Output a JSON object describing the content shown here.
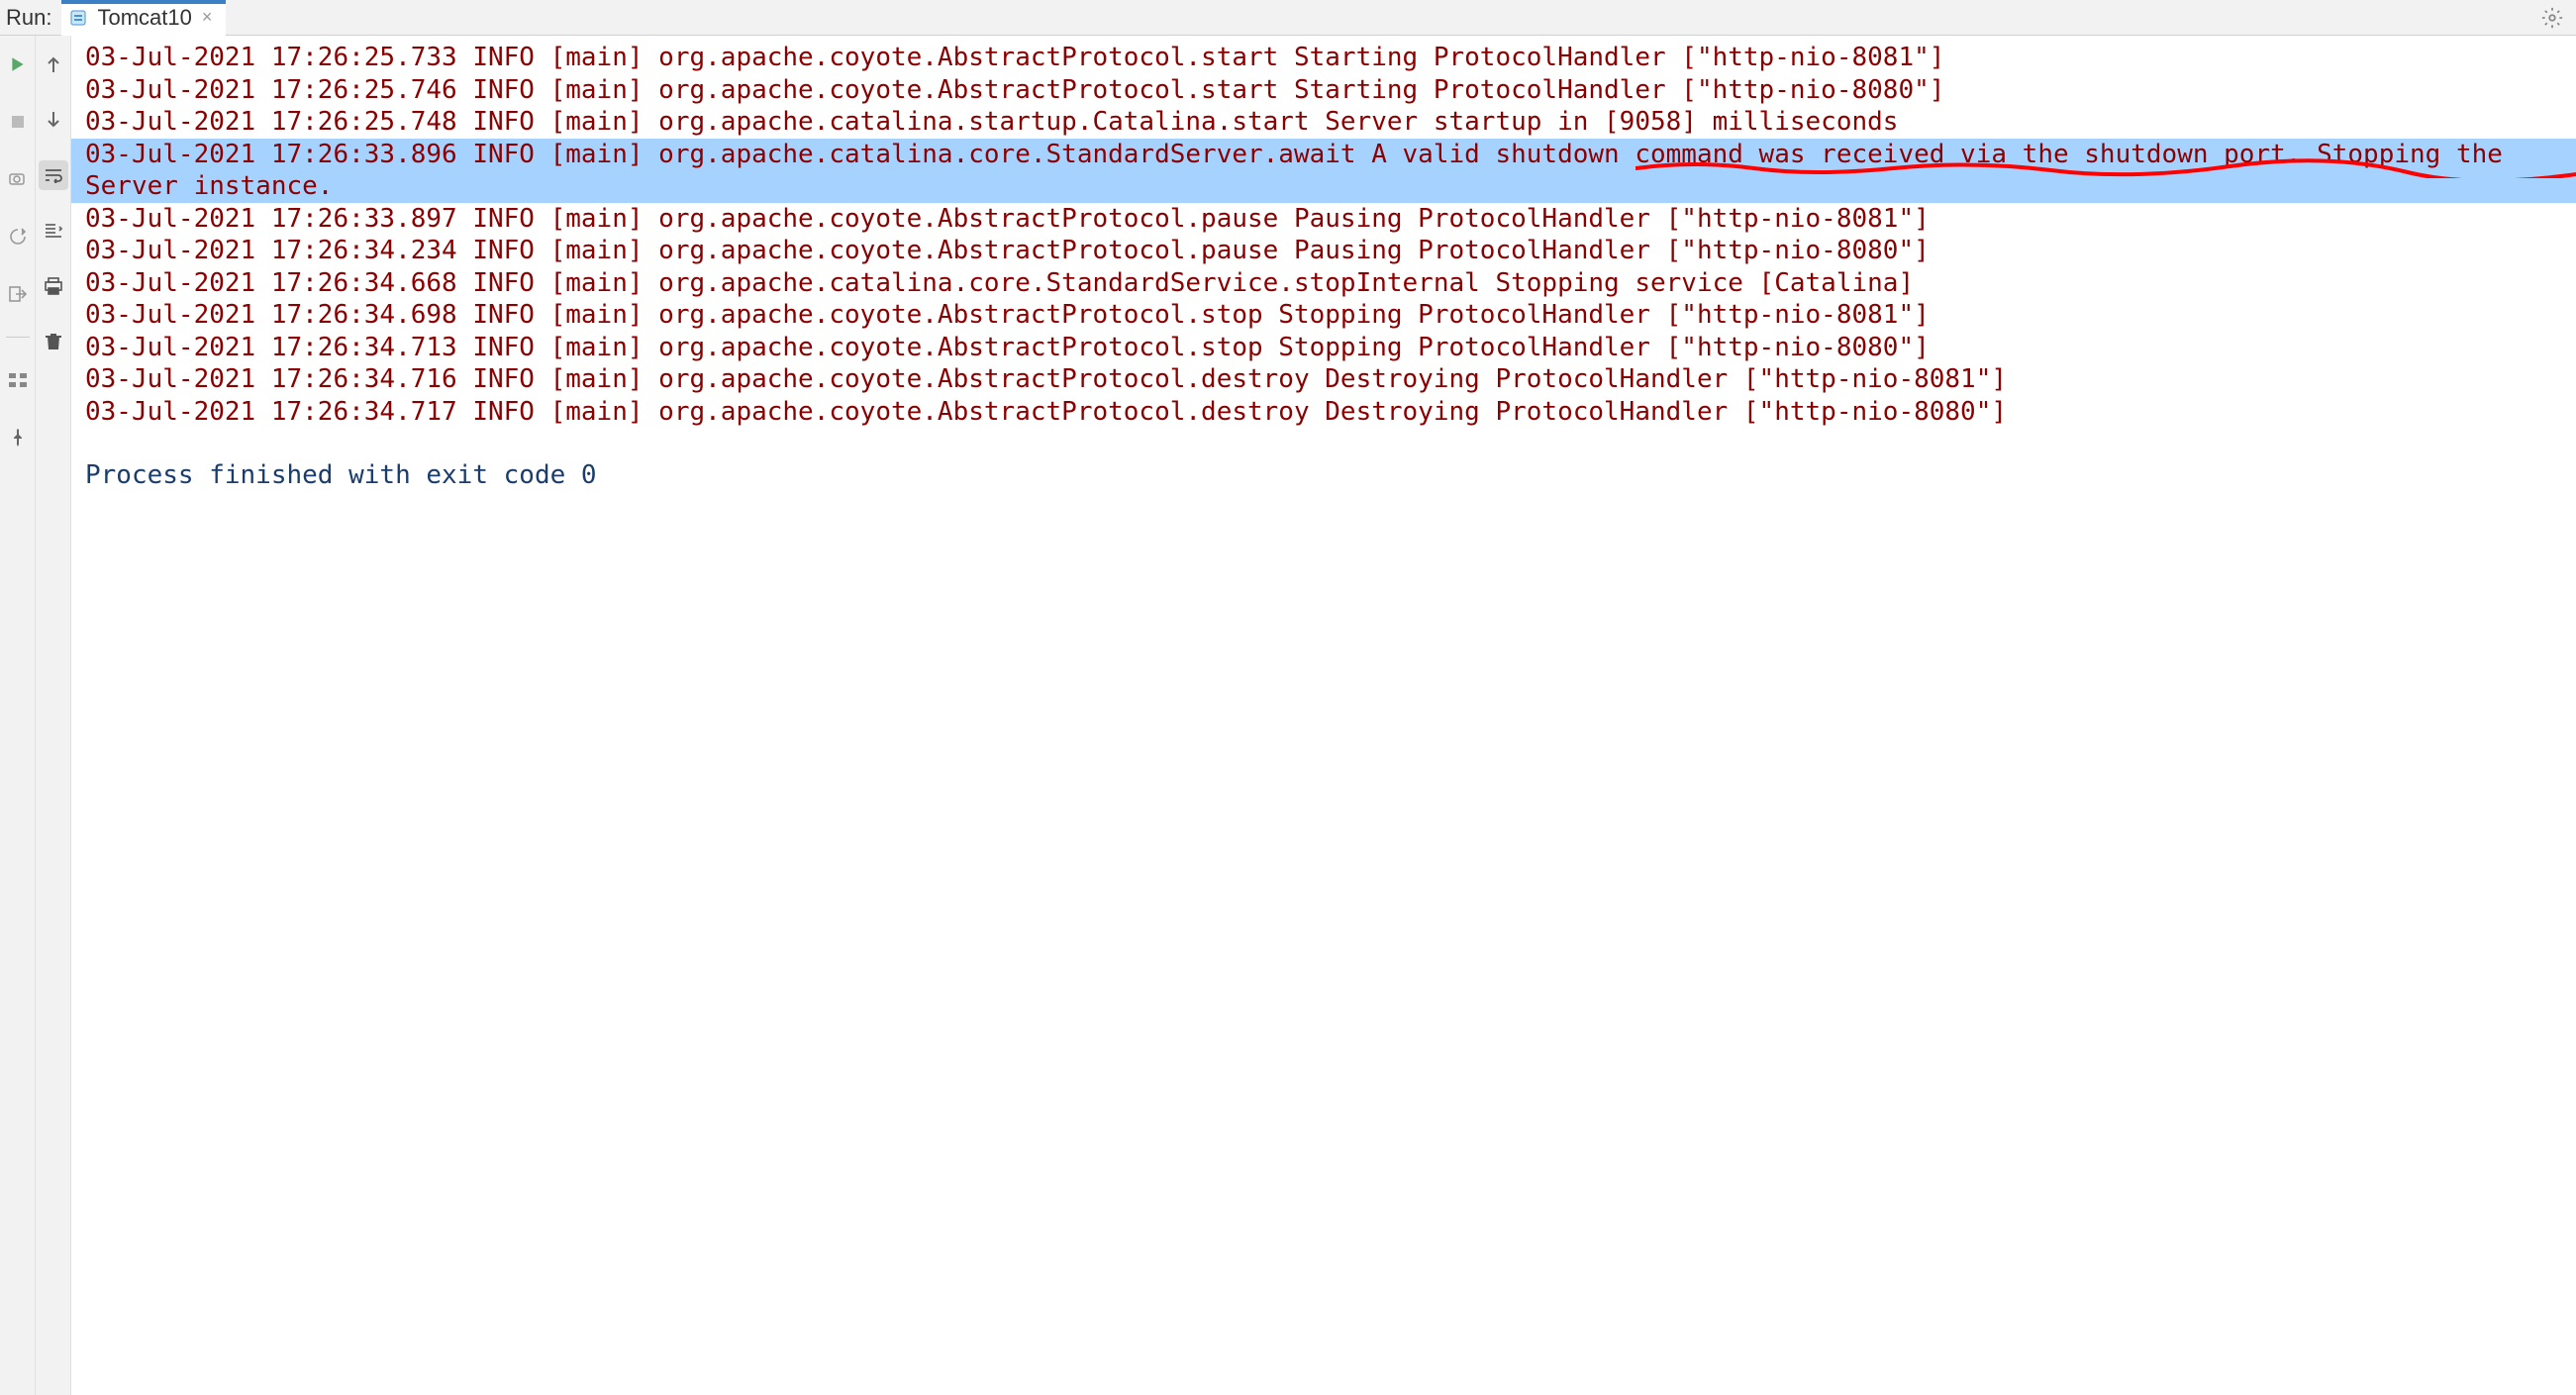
{
  "header": {
    "run_label": "Run:",
    "tab_label": "Tomcat10"
  },
  "logs": [
    {
      "text": "03-Jul-2021 17:26:25.733 INFO [main] org.apache.coyote.AbstractProtocol.start Starting ProtocolHandler [\"http-nio-8081\"]",
      "cls": "log"
    },
    {
      "text": "03-Jul-2021 17:26:25.746 INFO [main] org.apache.coyote.AbstractProtocol.start Starting ProtocolHandler [\"http-nio-8080\"]",
      "cls": "log"
    },
    {
      "text": "03-Jul-2021 17:26:25.748 INFO [main] org.apache.catalina.startup.Catalina.start Server startup in [9058] milliseconds",
      "cls": "log"
    },
    {
      "text": "03-Jul-2021 17:26:33.896 INFO [main] org.apache.catalina.core.StandardServer.await A valid shutdown command was received via the shutdown port. Stopping the Server instance.",
      "cls": "highlighted"
    },
    {
      "text": "03-Jul-2021 17:26:33.897 INFO [main] org.apache.coyote.AbstractProtocol.pause Pausing ProtocolHandler [\"http-nio-8081\"]",
      "cls": "log"
    },
    {
      "text": "03-Jul-2021 17:26:34.234 INFO [main] org.apache.coyote.AbstractProtocol.pause Pausing ProtocolHandler [\"http-nio-8080\"]",
      "cls": "log"
    },
    {
      "text": "03-Jul-2021 17:26:34.668 INFO [main] org.apache.catalina.core.StandardService.stopInternal Stopping service [Catalina]",
      "cls": "log"
    },
    {
      "text": "03-Jul-2021 17:26:34.698 INFO [main] org.apache.coyote.AbstractProtocol.stop Stopping ProtocolHandler [\"http-nio-8081\"]",
      "cls": "log"
    },
    {
      "text": "03-Jul-2021 17:26:34.713 INFO [main] org.apache.coyote.AbstractProtocol.stop Stopping ProtocolHandler [\"http-nio-8080\"]",
      "cls": "log"
    },
    {
      "text": "03-Jul-2021 17:26:34.716 INFO [main] org.apache.coyote.AbstractProtocol.destroy Destroying ProtocolHandler [\"http-nio-8081\"]",
      "cls": "log"
    },
    {
      "text": "03-Jul-2021 17:26:34.717 INFO [main] org.apache.coyote.AbstractProtocol.destroy Destroying ProtocolHandler [\"http-nio-8080\"]",
      "cls": "log"
    },
    {
      "text": "",
      "cls": "blank"
    },
    {
      "text": "Process finished with exit code 0",
      "cls": "normal"
    }
  ]
}
